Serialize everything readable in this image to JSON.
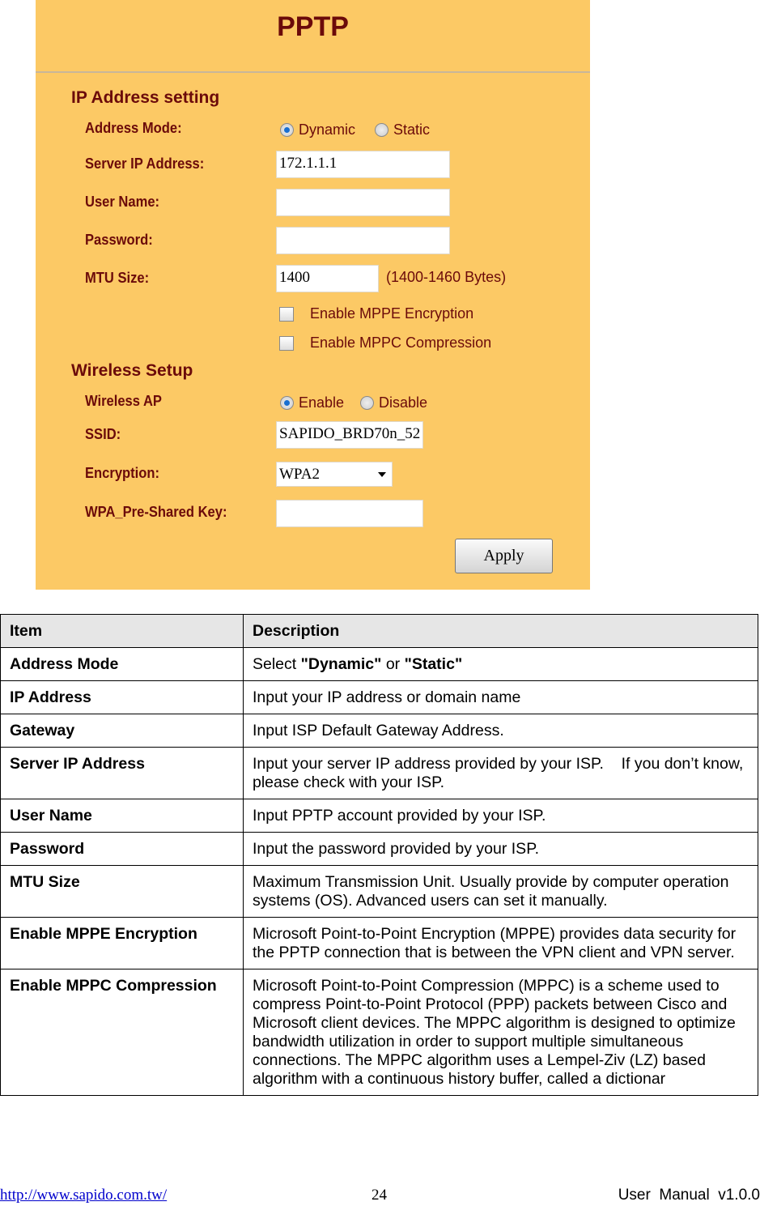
{
  "form": {
    "title": "PPTP",
    "ip_section": "IP Address setting",
    "address_mode_label": "Address Mode:",
    "address_mode_options": [
      "Dynamic",
      "Static"
    ],
    "address_mode_selected": "Dynamic",
    "server_ip_label": "Server IP Address:",
    "server_ip_value": "172.1.1.1",
    "user_name_label": "User Name:",
    "user_name_value": "",
    "password_label": "Password:",
    "password_value": "",
    "mtu_label": "MTU Size:",
    "mtu_value": "1400",
    "mtu_hint": "(1400-1460 Bytes)",
    "mppe_label": "Enable MPPE Encryption",
    "mppe_checked": false,
    "mppc_label": "Enable MPPC Compression",
    "mppc_checked": false,
    "wireless_section": "Wireless Setup",
    "wireless_ap_label": "Wireless AP",
    "wireless_ap_options": [
      "Enable",
      "Disable"
    ],
    "wireless_ap_selected": "Enable",
    "ssid_label": "SSID:",
    "ssid_value": "SAPIDO_BRD70n_52",
    "encryption_label": "Encryption:",
    "encryption_value": "WPA2",
    "psk_label": "WPA_Pre-Shared Key:",
    "psk_value": "",
    "apply_label": "Apply",
    "colors": {
      "background": "#fcc965",
      "label": "#6b0a0a"
    }
  },
  "table": {
    "headers": [
      "Item",
      "Description"
    ],
    "rows": [
      [
        "Address Mode",
        ""
      ],
      [
        "IP Address",
        "Input your IP address or domain name"
      ],
      [
        "Gateway",
        "Input ISP Default Gateway Address."
      ],
      [
        "Server IP Address",
        "Input your server IP address provided by your ISP.    If you don’t know, please check with your ISP."
      ],
      [
        "User Name",
        "Input PPTP account provided by your ISP."
      ],
      [
        "Password",
        "Input the password provided by your ISP."
      ],
      [
        "MTU Size",
        "Maximum Transmission Unit. Usually provide by computer operation systems (OS). Advanced users can set it manually."
      ],
      [
        "Enable MPPE Encryption",
        "Microsoft Point-to-Point Encryption (MPPE) provides data security for the PPTP connection that is between the VPN client and VPN server."
      ],
      [
        "Enable MPPC Compression",
        "Microsoft Point-to-Point Compression (MPPC) is a scheme used to compress Point-to-Point Protocol (PPP) packets between Cisco and Microsoft client devices. The MPPC algorithm is designed to optimize bandwidth utilization in order to support multiple simultaneous connections. The MPPC algorithm uses a Lempel-Ziv (LZ) based algorithm with a continuous history buffer, called a dictionar"
      ]
    ],
    "address_mode_desc": {
      "prefix": "Select ",
      "opt1": "\"Dynamic\"",
      "mid": " or ",
      "opt2": "\"Static\""
    }
  },
  "footer": {
    "url": "http://www.sapido.com.tw/",
    "page": "24",
    "manual": "User  Manual  v1.0.0"
  }
}
